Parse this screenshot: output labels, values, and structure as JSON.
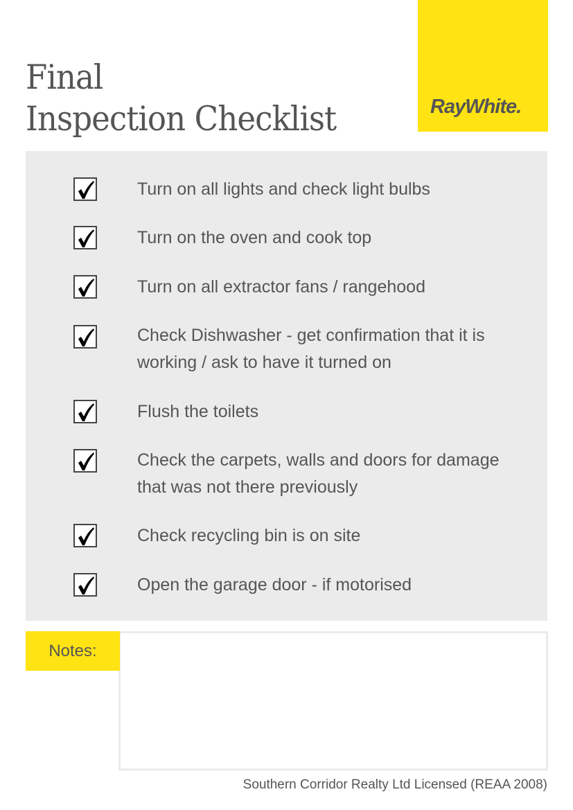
{
  "header": {
    "title_line1": "Final",
    "title_line2": "Inspection Checklist",
    "logo_text": "RayWhite."
  },
  "colors": {
    "brand_yellow": "#ffe312",
    "text_gray": "#555555",
    "panel_gray": "#ebebeb"
  },
  "checklist": {
    "items": [
      {
        "text": "Turn on all lights and check light bulbs",
        "checked": true
      },
      {
        "text": "Turn on the oven and cook top",
        "checked": true
      },
      {
        "text": "Turn on all extractor fans / rangehood",
        "checked": true
      },
      {
        "text": "Check Dishwasher - get confirmation that it is working / ask to have it turned on",
        "checked": true
      },
      {
        "text": "Flush the toilets",
        "checked": true
      },
      {
        "text": "Check the carpets, walls and doors for damage that was not there previously",
        "checked": true
      },
      {
        "text": "Check recycling bin is on site",
        "checked": true
      },
      {
        "text": "Open the garage door - if motorised",
        "checked": true
      }
    ]
  },
  "notes": {
    "label": "Notes:",
    "value": ""
  },
  "footer": {
    "text": "Southern Corridor Realty Ltd Licensed (REAA 2008)"
  }
}
